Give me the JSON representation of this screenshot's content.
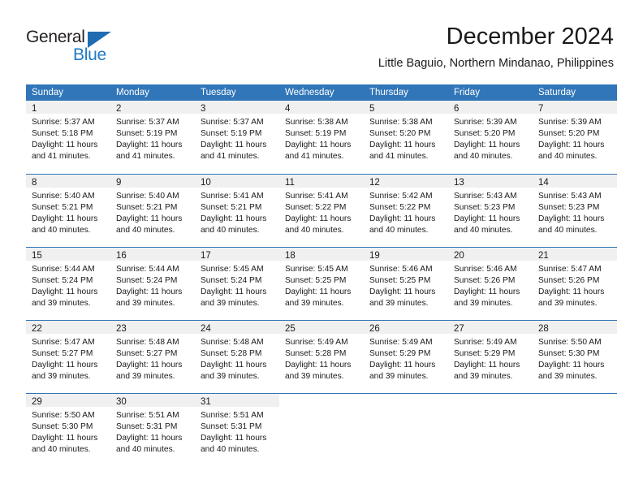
{
  "brand": {
    "name_part1": "General",
    "name_part2": "Blue",
    "triangle_color": "#1f6cb0",
    "blue_color": "#1f7ac4"
  },
  "header": {
    "title": "December 2024",
    "subtitle": "Little Baguio, Northern Mindanao, Philippines",
    "header_bg": "#3176b8",
    "day_band_bg": "#f0f0f0"
  },
  "weekdays": [
    "Sunday",
    "Monday",
    "Tuesday",
    "Wednesday",
    "Thursday",
    "Friday",
    "Saturday"
  ],
  "weeks": [
    [
      {
        "day": "1",
        "lines": [
          "Sunrise: 5:37 AM",
          "Sunset: 5:18 PM",
          "Daylight: 11 hours",
          "and 41 minutes."
        ]
      },
      {
        "day": "2",
        "lines": [
          "Sunrise: 5:37 AM",
          "Sunset: 5:19 PM",
          "Daylight: 11 hours",
          "and 41 minutes."
        ]
      },
      {
        "day": "3",
        "lines": [
          "Sunrise: 5:37 AM",
          "Sunset: 5:19 PM",
          "Daylight: 11 hours",
          "and 41 minutes."
        ]
      },
      {
        "day": "4",
        "lines": [
          "Sunrise: 5:38 AM",
          "Sunset: 5:19 PM",
          "Daylight: 11 hours",
          "and 41 minutes."
        ]
      },
      {
        "day": "5",
        "lines": [
          "Sunrise: 5:38 AM",
          "Sunset: 5:20 PM",
          "Daylight: 11 hours",
          "and 41 minutes."
        ]
      },
      {
        "day": "6",
        "lines": [
          "Sunrise: 5:39 AM",
          "Sunset: 5:20 PM",
          "Daylight: 11 hours",
          "and 40 minutes."
        ]
      },
      {
        "day": "7",
        "lines": [
          "Sunrise: 5:39 AM",
          "Sunset: 5:20 PM",
          "Daylight: 11 hours",
          "and 40 minutes."
        ]
      }
    ],
    [
      {
        "day": "8",
        "lines": [
          "Sunrise: 5:40 AM",
          "Sunset: 5:21 PM",
          "Daylight: 11 hours",
          "and 40 minutes."
        ]
      },
      {
        "day": "9",
        "lines": [
          "Sunrise: 5:40 AM",
          "Sunset: 5:21 PM",
          "Daylight: 11 hours",
          "and 40 minutes."
        ]
      },
      {
        "day": "10",
        "lines": [
          "Sunrise: 5:41 AM",
          "Sunset: 5:21 PM",
          "Daylight: 11 hours",
          "and 40 minutes."
        ]
      },
      {
        "day": "11",
        "lines": [
          "Sunrise: 5:41 AM",
          "Sunset: 5:22 PM",
          "Daylight: 11 hours",
          "and 40 minutes."
        ]
      },
      {
        "day": "12",
        "lines": [
          "Sunrise: 5:42 AM",
          "Sunset: 5:22 PM",
          "Daylight: 11 hours",
          "and 40 minutes."
        ]
      },
      {
        "day": "13",
        "lines": [
          "Sunrise: 5:43 AM",
          "Sunset: 5:23 PM",
          "Daylight: 11 hours",
          "and 40 minutes."
        ]
      },
      {
        "day": "14",
        "lines": [
          "Sunrise: 5:43 AM",
          "Sunset: 5:23 PM",
          "Daylight: 11 hours",
          "and 40 minutes."
        ]
      }
    ],
    [
      {
        "day": "15",
        "lines": [
          "Sunrise: 5:44 AM",
          "Sunset: 5:24 PM",
          "Daylight: 11 hours",
          "and 39 minutes."
        ]
      },
      {
        "day": "16",
        "lines": [
          "Sunrise: 5:44 AM",
          "Sunset: 5:24 PM",
          "Daylight: 11 hours",
          "and 39 minutes."
        ]
      },
      {
        "day": "17",
        "lines": [
          "Sunrise: 5:45 AM",
          "Sunset: 5:24 PM",
          "Daylight: 11 hours",
          "and 39 minutes."
        ]
      },
      {
        "day": "18",
        "lines": [
          "Sunrise: 5:45 AM",
          "Sunset: 5:25 PM",
          "Daylight: 11 hours",
          "and 39 minutes."
        ]
      },
      {
        "day": "19",
        "lines": [
          "Sunrise: 5:46 AM",
          "Sunset: 5:25 PM",
          "Daylight: 11 hours",
          "and 39 minutes."
        ]
      },
      {
        "day": "20",
        "lines": [
          "Sunrise: 5:46 AM",
          "Sunset: 5:26 PM",
          "Daylight: 11 hours",
          "and 39 minutes."
        ]
      },
      {
        "day": "21",
        "lines": [
          "Sunrise: 5:47 AM",
          "Sunset: 5:26 PM",
          "Daylight: 11 hours",
          "and 39 minutes."
        ]
      }
    ],
    [
      {
        "day": "22",
        "lines": [
          "Sunrise: 5:47 AM",
          "Sunset: 5:27 PM",
          "Daylight: 11 hours",
          "and 39 minutes."
        ]
      },
      {
        "day": "23",
        "lines": [
          "Sunrise: 5:48 AM",
          "Sunset: 5:27 PM",
          "Daylight: 11 hours",
          "and 39 minutes."
        ]
      },
      {
        "day": "24",
        "lines": [
          "Sunrise: 5:48 AM",
          "Sunset: 5:28 PM",
          "Daylight: 11 hours",
          "and 39 minutes."
        ]
      },
      {
        "day": "25",
        "lines": [
          "Sunrise: 5:49 AM",
          "Sunset: 5:28 PM",
          "Daylight: 11 hours",
          "and 39 minutes."
        ]
      },
      {
        "day": "26",
        "lines": [
          "Sunrise: 5:49 AM",
          "Sunset: 5:29 PM",
          "Daylight: 11 hours",
          "and 39 minutes."
        ]
      },
      {
        "day": "27",
        "lines": [
          "Sunrise: 5:49 AM",
          "Sunset: 5:29 PM",
          "Daylight: 11 hours",
          "and 39 minutes."
        ]
      },
      {
        "day": "28",
        "lines": [
          "Sunrise: 5:50 AM",
          "Sunset: 5:30 PM",
          "Daylight: 11 hours",
          "and 39 minutes."
        ]
      }
    ],
    [
      {
        "day": "29",
        "lines": [
          "Sunrise: 5:50 AM",
          "Sunset: 5:30 PM",
          "Daylight: 11 hours",
          "and 40 minutes."
        ]
      },
      {
        "day": "30",
        "lines": [
          "Sunrise: 5:51 AM",
          "Sunset: 5:31 PM",
          "Daylight: 11 hours",
          "and 40 minutes."
        ]
      },
      {
        "day": "31",
        "lines": [
          "Sunrise: 5:51 AM",
          "Sunset: 5:31 PM",
          "Daylight: 11 hours",
          "and 40 minutes."
        ]
      },
      {
        "day": "",
        "lines": []
      },
      {
        "day": "",
        "lines": []
      },
      {
        "day": "",
        "lines": []
      },
      {
        "day": "",
        "lines": []
      }
    ]
  ]
}
